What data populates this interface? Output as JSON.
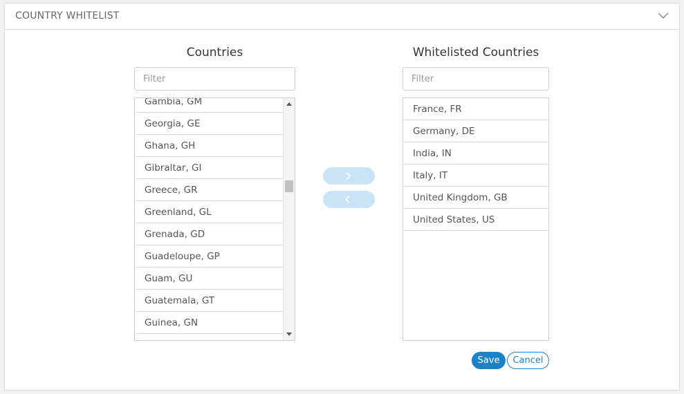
{
  "panel": {
    "title": "COUNTRY WHITELIST",
    "collapse_icon": "chevron-down-icon"
  },
  "available": {
    "title": "Countries",
    "filter_placeholder": "Filter",
    "items": [
      "Gambia, GM",
      "Georgia, GE",
      "Ghana, GH",
      "Gibraltar, GI",
      "Greece, GR",
      "Greenland, GL",
      "Grenada, GD",
      "Guadeloupe, GP",
      "Guam, GU",
      "Guatemala, GT",
      "Guinea, GN"
    ]
  },
  "whitelisted": {
    "title": "Whitelisted Countries",
    "filter_placeholder": "Filter",
    "items": [
      "France, FR",
      "Germany, DE",
      "India, IN",
      "Italy, IT",
      "United Kingdom, GB",
      "United States, US"
    ]
  },
  "transfer": {
    "add_icon": "chevron-right-icon",
    "remove_icon": "chevron-left-icon"
  },
  "actions": {
    "save_label": "Save",
    "cancel_label": "Cancel"
  },
  "colors": {
    "primary": "#1c82c6",
    "transfer_button": "#c9e4f7"
  }
}
